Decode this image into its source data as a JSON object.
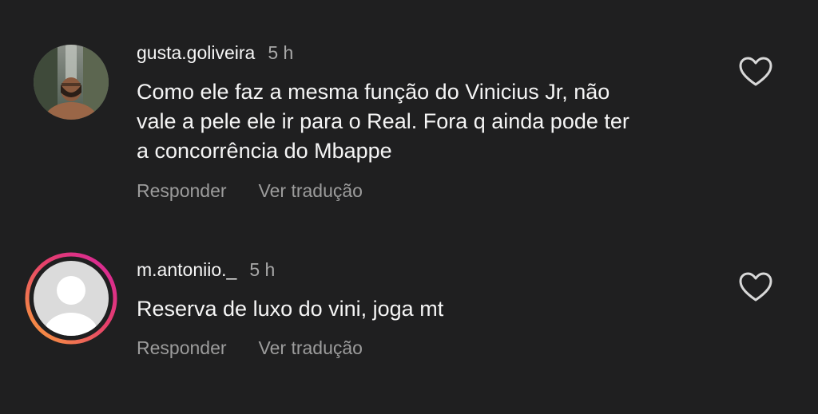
{
  "comments": [
    {
      "username": "gusta.goliveira",
      "time": "5 h",
      "text": "Como ele faz a mesma função do Vinicius Jr, não\nvale a pele ele ir para o Real. Fora q ainda pode ter\na concorrência do Mbappe",
      "reply_label": "Responder",
      "translate_label": "Ver tradução",
      "like_icon": "heart-outline-icon",
      "avatar": "profile-photo"
    },
    {
      "username": "m.antoniio._",
      "time": "5 h",
      "text": "Reserva de luxo do vini, joga mt",
      "reply_label": "Responder",
      "translate_label": "Ver tradução",
      "like_icon": "heart-outline-icon",
      "avatar": "default-avatar-with-story-ring"
    }
  ],
  "colors": {
    "background": "#1f1f20",
    "primary_text": "#f5f5f5",
    "secondary_text": "#a8a8a8",
    "story_ring_start": "#f9a13a",
    "story_ring_end": "#d6249f"
  }
}
